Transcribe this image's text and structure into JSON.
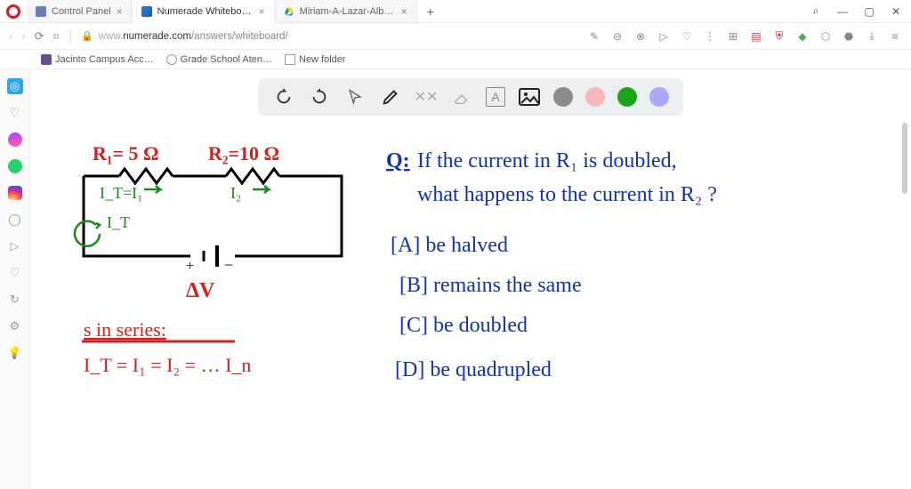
{
  "browser": {
    "tabs": [
      {
        "label": "Control Panel",
        "active": false
      },
      {
        "label": "Numerade Whiteboard",
        "active": true
      },
      {
        "label": "Miriam-A-Lazar-Albert-Ta…",
        "active": false
      }
    ],
    "newtab_glyph": "+",
    "win": {
      "search": "⌕",
      "min": "—",
      "max": "▢",
      "close": "✕"
    }
  },
  "nav": {
    "back": "‹",
    "forward": "›",
    "reload": "⟳",
    "tiles": "⌗",
    "lock": "🔒",
    "url_host_dim": "www.",
    "url_host": "numerade.com",
    "url_path": "/answers/whiteboard/"
  },
  "ext": {
    "items": [
      "✎",
      "⊝",
      "⊗",
      "▷",
      "♡",
      "⋮",
      "⊞",
      "▤",
      "⛨",
      "◆",
      "⬡",
      "⬣",
      "⤓",
      "≡"
    ]
  },
  "bookmarks": [
    {
      "icon": "purple",
      "label": "Jacinto Campus Acc…"
    },
    {
      "icon": "gray",
      "label": "Grade School Aten…"
    },
    {
      "icon": "folder",
      "label": "New folder"
    }
  ],
  "sidebar": {
    "items": [
      "home",
      "heart",
      "messenger",
      "whatsapp",
      "instagram",
      "circle",
      "play",
      "heart2",
      "clock",
      "gear",
      "bulb"
    ]
  },
  "toolbar": {
    "undo": "↺",
    "redo": "↻",
    "cursor": "↖",
    "pencil": "✎",
    "tools": "⚒",
    "eraser": "◧",
    "text": "A",
    "image": "🖼",
    "colors": [
      "#8b8b8b",
      "#f4b8b8",
      "#1aa51a",
      "#a9a9f7"
    ]
  },
  "whiteboard": {
    "r1_label": "R₁= 5 Ω",
    "r2_label": "R₂=10 Ω",
    "it_label": "I_T",
    "i1_label": "I_T=I₁",
    "i2_label": "I₂",
    "dv_label": "ΔV",
    "series_rule_title": "s in series:",
    "series_rule_eq": "I_T = I₁ = I₂ = … I_n",
    "q_prefix": "Q:",
    "q_line1": "If the current in R₁ is doubled,",
    "q_line2": "what happens to the current in R₂ ?",
    "opt_a": "[A] be halved",
    "opt_b": "[B] remains the same",
    "opt_c": "[C] be doubled",
    "opt_d": "[D] be quadrupled"
  }
}
